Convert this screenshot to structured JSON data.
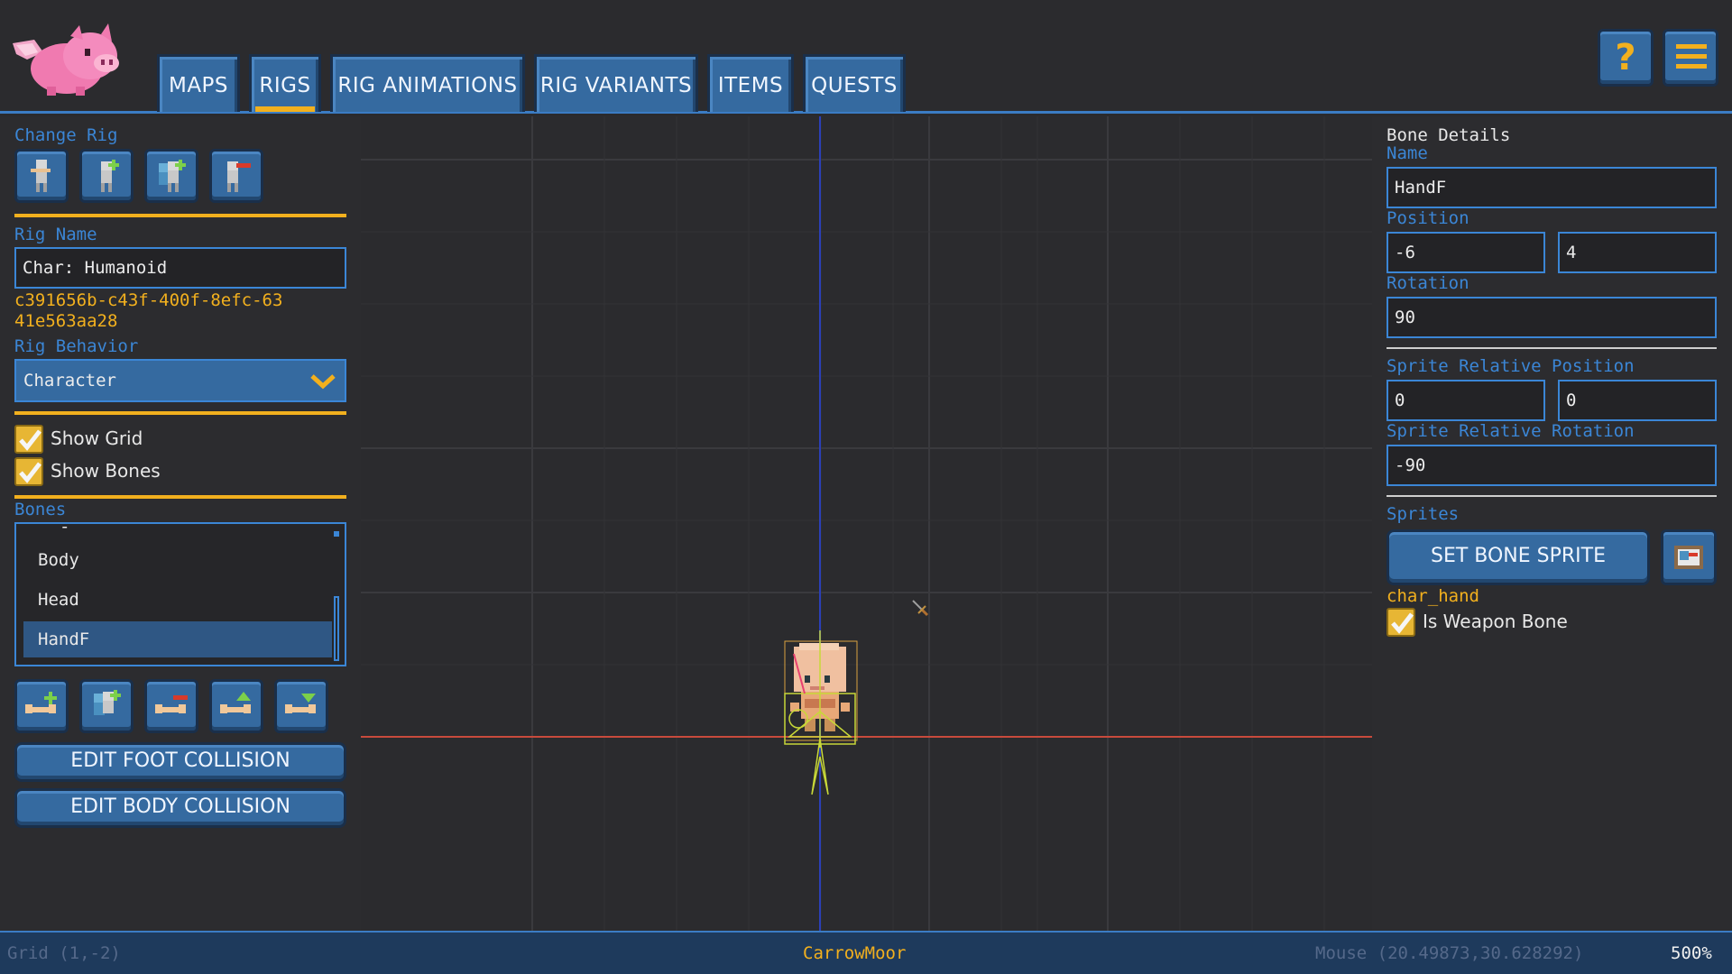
{
  "tabs": [
    {
      "label": "MAPS",
      "active": false
    },
    {
      "label": "RIGS",
      "active": true
    },
    {
      "label": "RIG ANIMATIONS",
      "active": false
    },
    {
      "label": "RIG VARIANTS",
      "active": false
    },
    {
      "label": "ITEMS",
      "active": false
    },
    {
      "label": "QUESTS",
      "active": false
    }
  ],
  "top_buttons": {
    "help_icon": "question-icon",
    "menu_icon": "hamburger-menu-icon"
  },
  "left": {
    "change_rig_label": "Change Rig",
    "rig_name_label": "Rig Name",
    "rig_name_value": "Char: Humanoid",
    "rig_id_line1": "c391656b-c43f-400f-8efc-63",
    "rig_id_line2": "41e563aa28",
    "rig_behavior_label": "Rig Behavior",
    "rig_behavior_value": "Character",
    "show_grid_label": "Show Grid",
    "show_grid_checked": true,
    "show_bones_label": "Show Bones",
    "show_bones_checked": true,
    "bones_label": "Bones",
    "bones_partial": "-",
    "bones": [
      "Body",
      "Head",
      "HandF"
    ],
    "selected_bone": "HandF",
    "edit_foot_collision": "EDIT FOOT COLLISION",
    "edit_body_collision": "EDIT BODY COLLISION"
  },
  "right": {
    "title": "Bone Details",
    "name_label": "Name",
    "name_value": "HandF",
    "position_label": "Position",
    "position_x": "-6",
    "position_y": "4",
    "rotation_label": "Rotation",
    "rotation_value": "90",
    "sprite_rel_pos_label": "Sprite Relative Position",
    "sprite_rel_pos_x": "0",
    "sprite_rel_pos_y": "0",
    "sprite_rel_rot_label": "Sprite Relative Rotation",
    "sprite_rel_rot_value": "-90",
    "sprites_label": "Sprites",
    "set_bone_sprite": "SET BONE SPRITE",
    "sprite_name": "char_hand",
    "is_weapon_bone_label": "Is Weapon Bone",
    "is_weapon_bone_checked": true
  },
  "status": {
    "grid": "Grid (1,-2)",
    "map_name": "CarrowMoor",
    "mouse": "Mouse (20.49873,30.628292)",
    "zoom": "500%"
  },
  "colors": {
    "accent_blue": "#3b86d6",
    "accent_yellow": "#f2b01e",
    "button_blue": "#356aa0",
    "axis_red": "#c84a3c",
    "axis_blue": "#2b3fb8"
  }
}
